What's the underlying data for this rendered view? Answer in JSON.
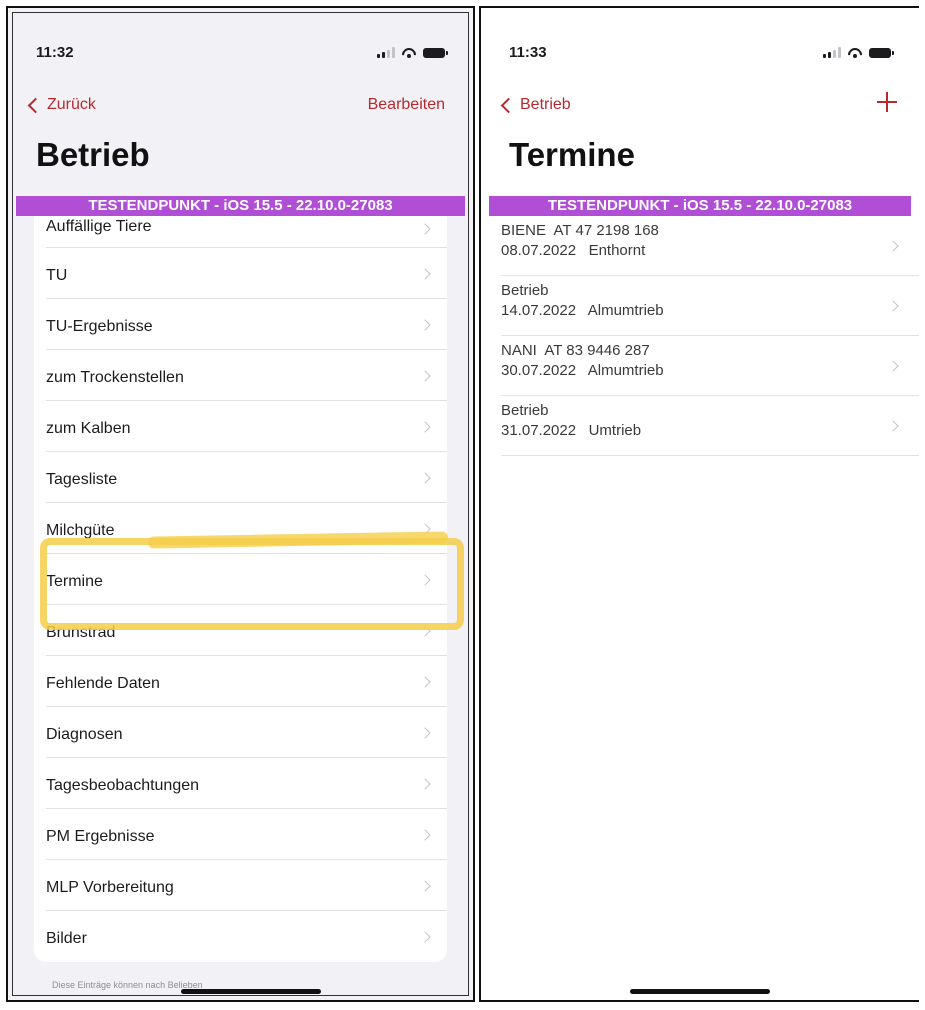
{
  "left_screen": {
    "time": "11:32",
    "back_label": "Zurück",
    "edit_label": "Bearbeiten",
    "title": "Betrieb",
    "banner": "TESTENDPUNKT - iOS 15.5 - 22.10.0-27083",
    "items": [
      "Auffällige Tiere",
      "TU",
      "TU-Ergebnisse",
      "zum Trockenstellen",
      "zum Kalben",
      "Tagesliste",
      "Milchgüte",
      "Termine",
      "Brunstrad",
      "Fehlende Daten",
      "Diagnosen",
      "Tagesbeobachtungen",
      "PM Ergebnisse",
      "MLP Vorbereitung",
      "Bilder"
    ],
    "footer_note": "Diese Einträge können nach Belieben"
  },
  "right_screen": {
    "time": "11:33",
    "back_label": "Betrieb",
    "title": "Termine",
    "banner": "TESTENDPUNKT - iOS 15.5 - 22.10.0-27083",
    "entries": [
      {
        "line1": "BIENE  AT 47 2198 168",
        "line2": "08.07.2022   Enthornt"
      },
      {
        "line1": "Betrieb",
        "line2": "14.07.2022   Almumtrieb"
      },
      {
        "line1": "NANI  AT 83 9446 287",
        "line2": "30.07.2022   Almumtrieb"
      },
      {
        "line1": "Betrieb",
        "line2": "31.07.2022   Umtrieb"
      }
    ]
  },
  "colors": {
    "accent": "#b8292f",
    "banner": "#b04ed6",
    "highlight": "#f4ce4a",
    "grouped_background": "#f2f1f6"
  },
  "icons": [
    "chevron-left-icon",
    "chevron-right-icon",
    "plus-icon",
    "cellular-signal-icon",
    "wifi-icon",
    "battery-icon"
  ]
}
